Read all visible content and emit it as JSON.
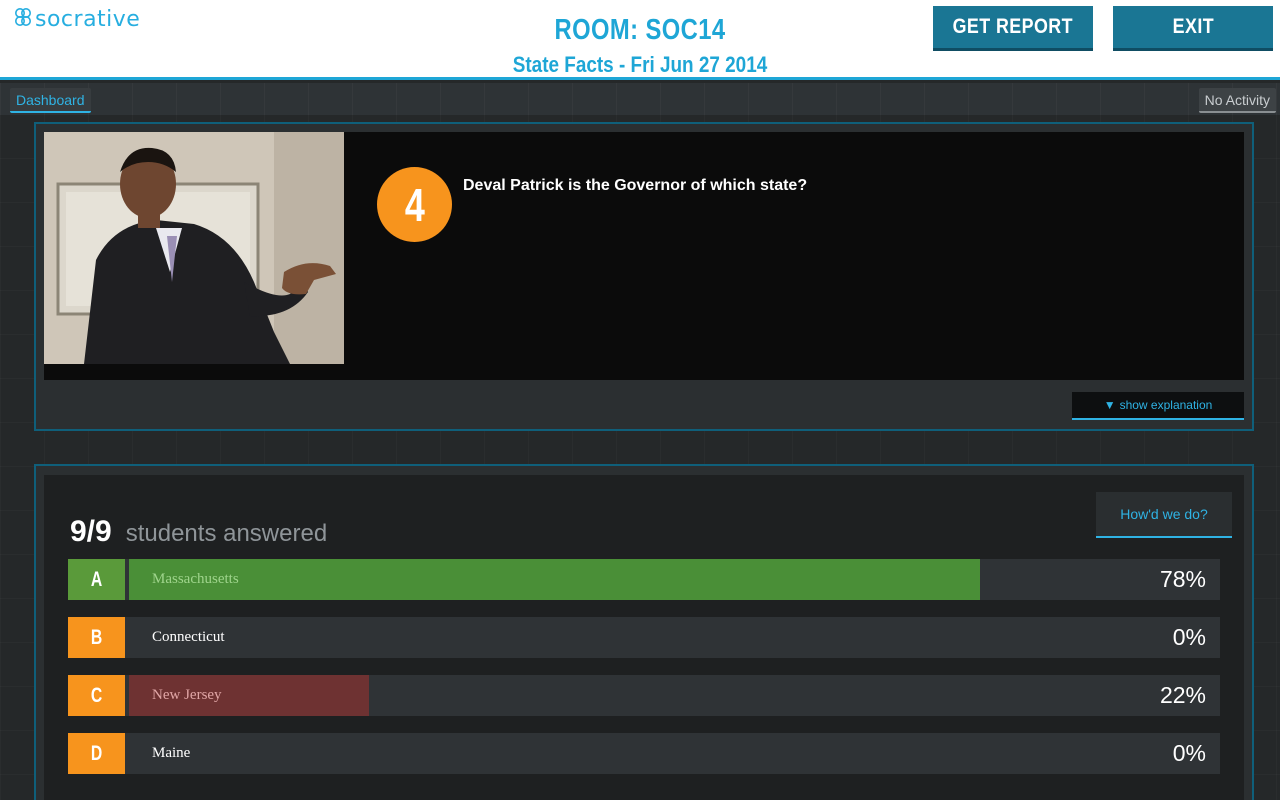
{
  "header": {
    "logo_text": "socrative",
    "room_title": "ROOM: SOC14",
    "subtitle": "State Facts - Fri Jun 27 2014",
    "get_report_label": "GET REPORT",
    "exit_label": "EXIT"
  },
  "nav": {
    "dashboard_label": "Dashboard",
    "activity_status": "No Activity"
  },
  "question": {
    "number": "4",
    "text": "Deval Patrick is the Governor of which state?",
    "show_explanation_label": "show explanation"
  },
  "results": {
    "answered_count": "9/9",
    "answered_label": "students answered",
    "howd_we_do_label": "How'd we do?",
    "answers": [
      {
        "letter": "A",
        "text": "Massachusetts",
        "percent_label": "78%",
        "percent": 78,
        "correct": true
      },
      {
        "letter": "B",
        "text": "Connecticut",
        "percent_label": "0%",
        "percent": 0,
        "correct": false
      },
      {
        "letter": "C",
        "text": "New Jersey",
        "percent_label": "22%",
        "percent": 22,
        "correct": false
      },
      {
        "letter": "D",
        "text": "Maine",
        "percent_label": "0%",
        "percent": 0,
        "correct": false
      }
    ]
  },
  "colors": {
    "accent": "#1ea6d6",
    "button": "#1a7694",
    "orange": "#f7941d",
    "correct_letter": "#5a9a3a",
    "correct_fill": "#4a8f37",
    "wrong_fill": "#6e3232"
  }
}
